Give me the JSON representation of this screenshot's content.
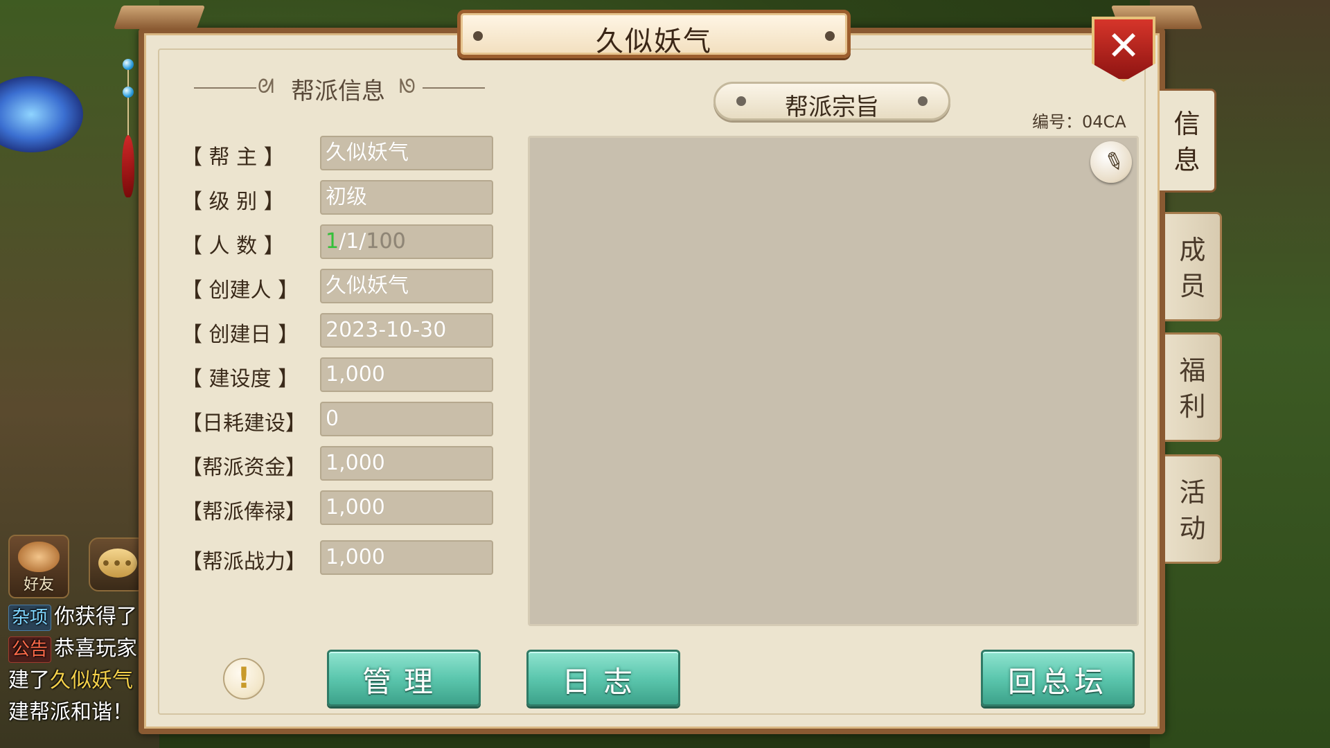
{
  "window": {
    "title": "久似妖气"
  },
  "info_section": {
    "title": "帮派信息"
  },
  "fields": [
    {
      "label": "【 帮  主 】",
      "value": "久似妖气"
    },
    {
      "label": "【 级  别 】",
      "value": "初级"
    },
    {
      "label": "【 人  数 】",
      "value": ""
    },
    {
      "label": "【 创建人 】",
      "value": "久似妖气"
    },
    {
      "label": "【 创建日 】",
      "value": "2023-10-30"
    },
    {
      "label": "【 建设度 】",
      "value": "1,000"
    },
    {
      "label": "【日耗建设】",
      "value": "0"
    },
    {
      "label": "【帮派资金】",
      "value": "1,000"
    },
    {
      "label": "【帮派俸禄】",
      "value": "1,000"
    },
    {
      "label": "【帮派战力】",
      "value": "1,000"
    }
  ],
  "member_count": {
    "online": "1",
    "current": "1",
    "max": "100",
    "sep": "/"
  },
  "purpose": {
    "title": "帮派宗旨",
    "guild_id": "编号：04CA",
    "text": ""
  },
  "side_tabs": [
    {
      "label": "信\n息",
      "active": true
    },
    {
      "label": "成\n员",
      "active": false
    },
    {
      "label": "福\n利",
      "active": false
    },
    {
      "label": "活\n动",
      "active": false
    }
  ],
  "buttons": {
    "manage": "管理",
    "log": "日志",
    "back": "回总坛",
    "close": "✕",
    "info": "!"
  },
  "hud": {
    "friends_label": "好友",
    "chat": [
      {
        "tag": "杂项",
        "text": "你获得了"
      },
      {
        "tag": "公告",
        "text": "恭喜玩家"
      },
      {
        "prefix": "建了",
        "highlight": "久似妖气",
        "text": ""
      },
      {
        "text": "建帮派和谐！"
      }
    ]
  },
  "colors": {
    "accent_green": "#33c23a",
    "button_teal": "#5cc7ae",
    "panel_border": "#8a5a32",
    "close_red": "#c8281f"
  }
}
